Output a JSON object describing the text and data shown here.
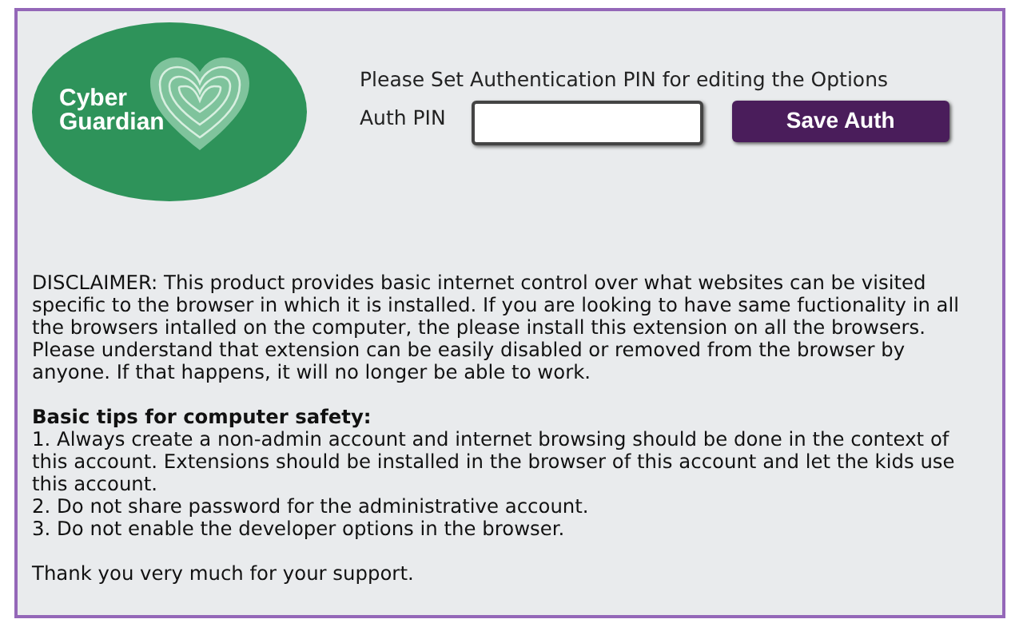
{
  "logo": {
    "lines": [
      "Cyber",
      "Guardian"
    ]
  },
  "auth": {
    "prompt": "Please Set Authentication PIN for editing the Options",
    "label": "Auth PIN",
    "button": "Save Auth"
  },
  "disclaimer": "DISCLAIMER: This product provides basic internet control over what websites can be visited specific to the browser in which it is installed. If you are looking to have same fuctionality in all the browsers intalled on the computer, the please install this extension on all the browsers. Please understand that extension can be easily disabled or removed from the browser by anyone. If that happens, it will no longer be able to work.",
  "tips": {
    "heading": "Basic tips for computer safety:",
    "items": [
      "1. Always create a non-admin account and internet browsing should be done in the context of this account. Extensions should be installed in the browser of this account and let the kids use this account.",
      "2. Do not share password for the administrative account.",
      "3. Do not enable the developer options in the browser."
    ]
  },
  "thanks": "Thank you very much for your support."
}
